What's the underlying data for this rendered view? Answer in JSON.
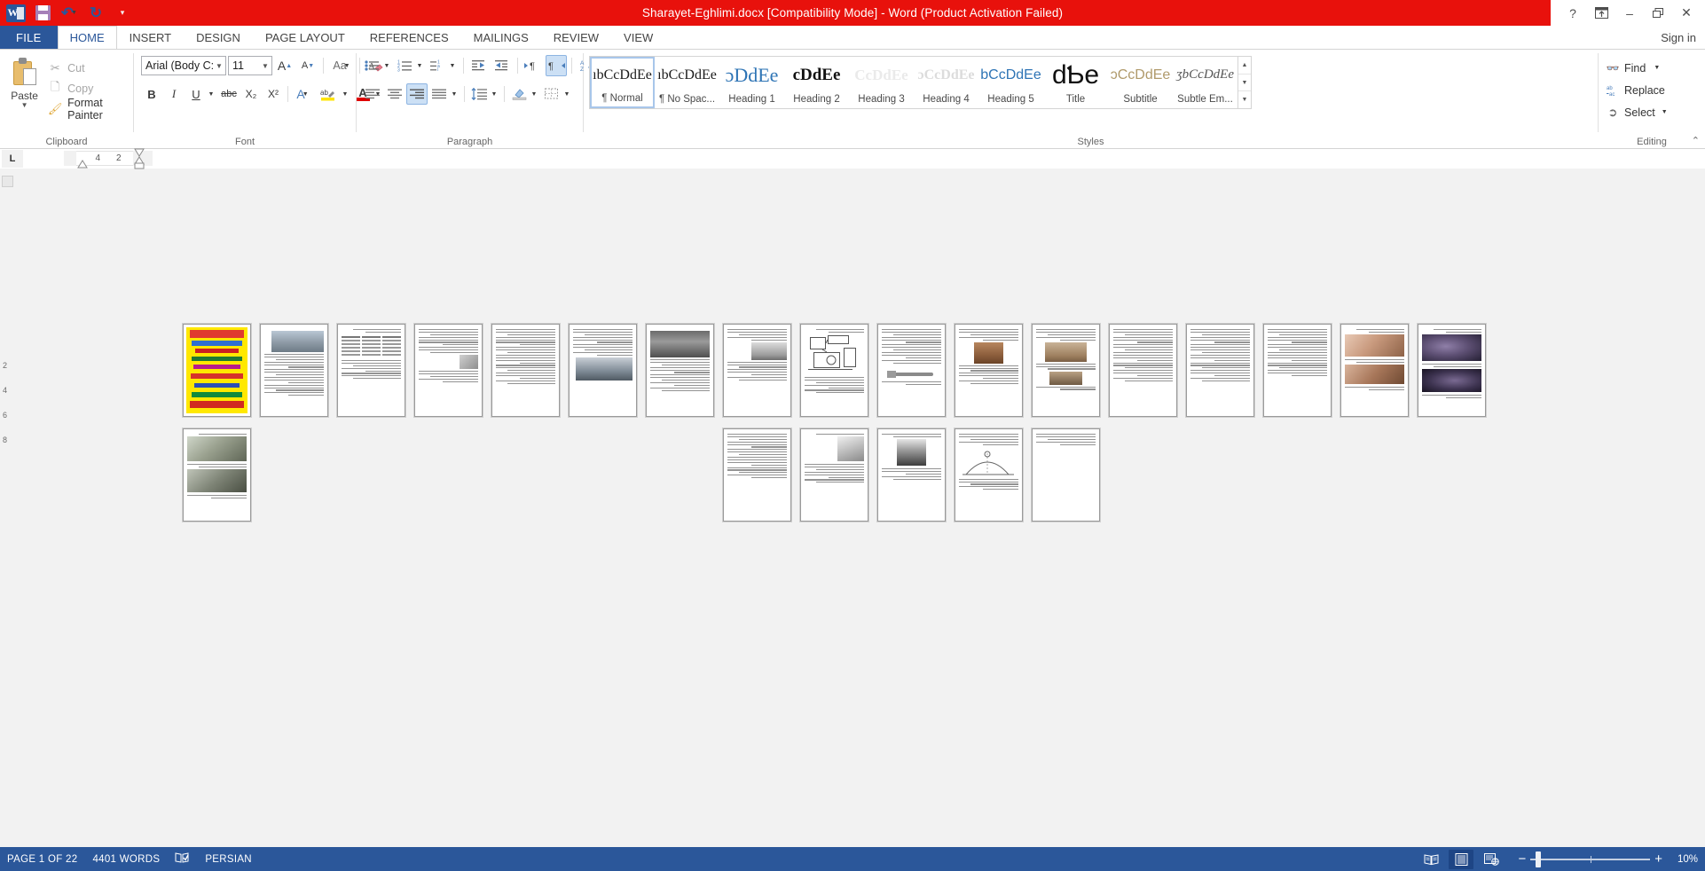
{
  "window": {
    "title": "Sharayet-Eghlimi.docx [Compatibility Mode]  -  Word (Product Activation Failed)",
    "help_icon": "?",
    "ribbon_display_icon": "ribbon-display-options-icon",
    "minimize_icon": "–",
    "restore_icon": "❐",
    "close_icon": "✕"
  },
  "quick_access": {
    "app_logo": "word-logo",
    "save_label": "Save",
    "undo_label": "Undo",
    "redo_label": "Repeat",
    "customize_label": "Customize Quick Access Toolbar"
  },
  "tabs": {
    "file": "FILE",
    "items": [
      {
        "label": "HOME",
        "active": true
      },
      {
        "label": "INSERT",
        "active": false
      },
      {
        "label": "DESIGN",
        "active": false
      },
      {
        "label": "PAGE LAYOUT",
        "active": false
      },
      {
        "label": "REFERENCES",
        "active": false
      },
      {
        "label": "MAILINGS",
        "active": false
      },
      {
        "label": "REVIEW",
        "active": false
      },
      {
        "label": "VIEW",
        "active": false
      }
    ],
    "sign_in": "Sign in"
  },
  "ribbon": {
    "clipboard": {
      "label": "Clipboard",
      "paste": "Paste",
      "cut": "Cut",
      "copy": "Copy",
      "format_painter": "Format Painter"
    },
    "font": {
      "label": "Font",
      "font_name": "Arial (Body C:",
      "font_size": "11",
      "grow_font": "A",
      "shrink_font": "A",
      "change_case": "Aa",
      "clear_formatting": "Clear All Formatting",
      "bold": "B",
      "italic": "I",
      "underline": "U",
      "strikethrough": "abc",
      "subscript": "X₂",
      "superscript": "X²",
      "text_effects": "A",
      "highlight": "Text Highlight Color",
      "font_color": "A"
    },
    "paragraph": {
      "label": "Paragraph",
      "bullets": "Bullets",
      "numbering": "Numbering",
      "multilevel": "Multilevel List",
      "decrease_indent": "Decrease Indent",
      "increase_indent": "Increase Indent",
      "ltr": "Left-to-Right Text Direction",
      "rtl": "Right-to-Left Text Direction",
      "sort": "Sort",
      "show_marks": "¶",
      "align_left": "Align Left",
      "align_center": "Center",
      "align_right": "Align Right",
      "justify": "Justify",
      "line_spacing": "Line and Paragraph Spacing",
      "shading": "Shading",
      "borders": "Borders",
      "rtl_active": true,
      "align_right_active": true
    },
    "styles": {
      "label": "Styles",
      "items": [
        {
          "preview": "ıbCcDdEe",
          "name": "¶ Normal",
          "selected": true,
          "css": "normal"
        },
        {
          "preview": "ıbCcDdEe",
          "name": "¶ No Spac...",
          "selected": false,
          "css": "nospacing"
        },
        {
          "preview": "ɔDdEe",
          "name": "Heading 1",
          "selected": false,
          "css": "h1"
        },
        {
          "preview": "cDdEe",
          "name": "Heading 2",
          "selected": false,
          "css": "h2"
        },
        {
          "preview": "CcDdEe",
          "name": "Heading 3",
          "selected": false,
          "css": "h3"
        },
        {
          "preview": "ɔCcDdEe",
          "name": "Heading 4",
          "selected": false,
          "css": "h4"
        },
        {
          "preview": "bCcDdEe",
          "name": "Heading 5",
          "selected": false,
          "css": "h5"
        },
        {
          "preview": "dƄe",
          "name": "Title",
          "selected": false,
          "css": "title"
        },
        {
          "preview": "ɔCcDdEe",
          "name": "Subtitle",
          "selected": false,
          "css": "subtitle"
        },
        {
          "preview": "ʒbCcDdEe",
          "name": "Subtle Em...",
          "selected": false,
          "css": "subtleem"
        }
      ]
    },
    "editing": {
      "label": "Editing",
      "find": "Find",
      "replace": "Replace",
      "select": "Select"
    },
    "collapse_icon": "⌃"
  },
  "ruler": {
    "tab_stop": "L",
    "marks": [
      "4",
      "2"
    ]
  },
  "document": {
    "zoom_percent": "10%",
    "page_thumbnails": [
      {
        "index": 1,
        "kind": "cover-yellow"
      },
      {
        "index": 2,
        "kind": "text-image-top"
      },
      {
        "index": 3,
        "kind": "table"
      },
      {
        "index": 4,
        "kind": "text-image-right"
      },
      {
        "index": 5,
        "kind": "text-only"
      },
      {
        "index": 6,
        "kind": "text-image-bottom"
      },
      {
        "index": 7,
        "kind": "image-top-text"
      },
      {
        "index": 8,
        "kind": "text-image-mid"
      },
      {
        "index": 9,
        "kind": "diagram"
      },
      {
        "index": 10,
        "kind": "text-only"
      },
      {
        "index": 11,
        "kind": "text-image-mid"
      },
      {
        "index": 12,
        "kind": "text-image-mid"
      },
      {
        "index": 13,
        "kind": "text-only"
      },
      {
        "index": 14,
        "kind": "text-only"
      },
      {
        "index": 15,
        "kind": "text-only"
      },
      {
        "index": 16,
        "kind": "image-pair"
      },
      {
        "index": 17,
        "kind": "image-dark"
      },
      {
        "index": 18,
        "kind": "image-pair"
      },
      {
        "index": 19,
        "kind": "text-only"
      },
      {
        "index": 20,
        "kind": "text-image-top"
      },
      {
        "index": 21,
        "kind": "text-image-mid"
      },
      {
        "index": 22,
        "kind": "diagram"
      },
      {
        "index": 23,
        "kind": "text-short"
      }
    ]
  },
  "status_bar": {
    "page": "PAGE 1 OF 22",
    "words": "4401 WORDS",
    "proofing_icon": "proofing-errors-icon",
    "language": "PERSIAN",
    "read_mode": "Read Mode",
    "print_layout": "Print Layout",
    "web_layout": "Web Layout",
    "zoom_out": "−",
    "zoom_in": "+",
    "zoom_value": "10%"
  },
  "colors": {
    "title_bar": "#e8110c",
    "accent": "#2b579a",
    "ribbon_bg": "#ffffff",
    "doc_bg": "#f2f2f2",
    "selection": "#cce0f5"
  }
}
